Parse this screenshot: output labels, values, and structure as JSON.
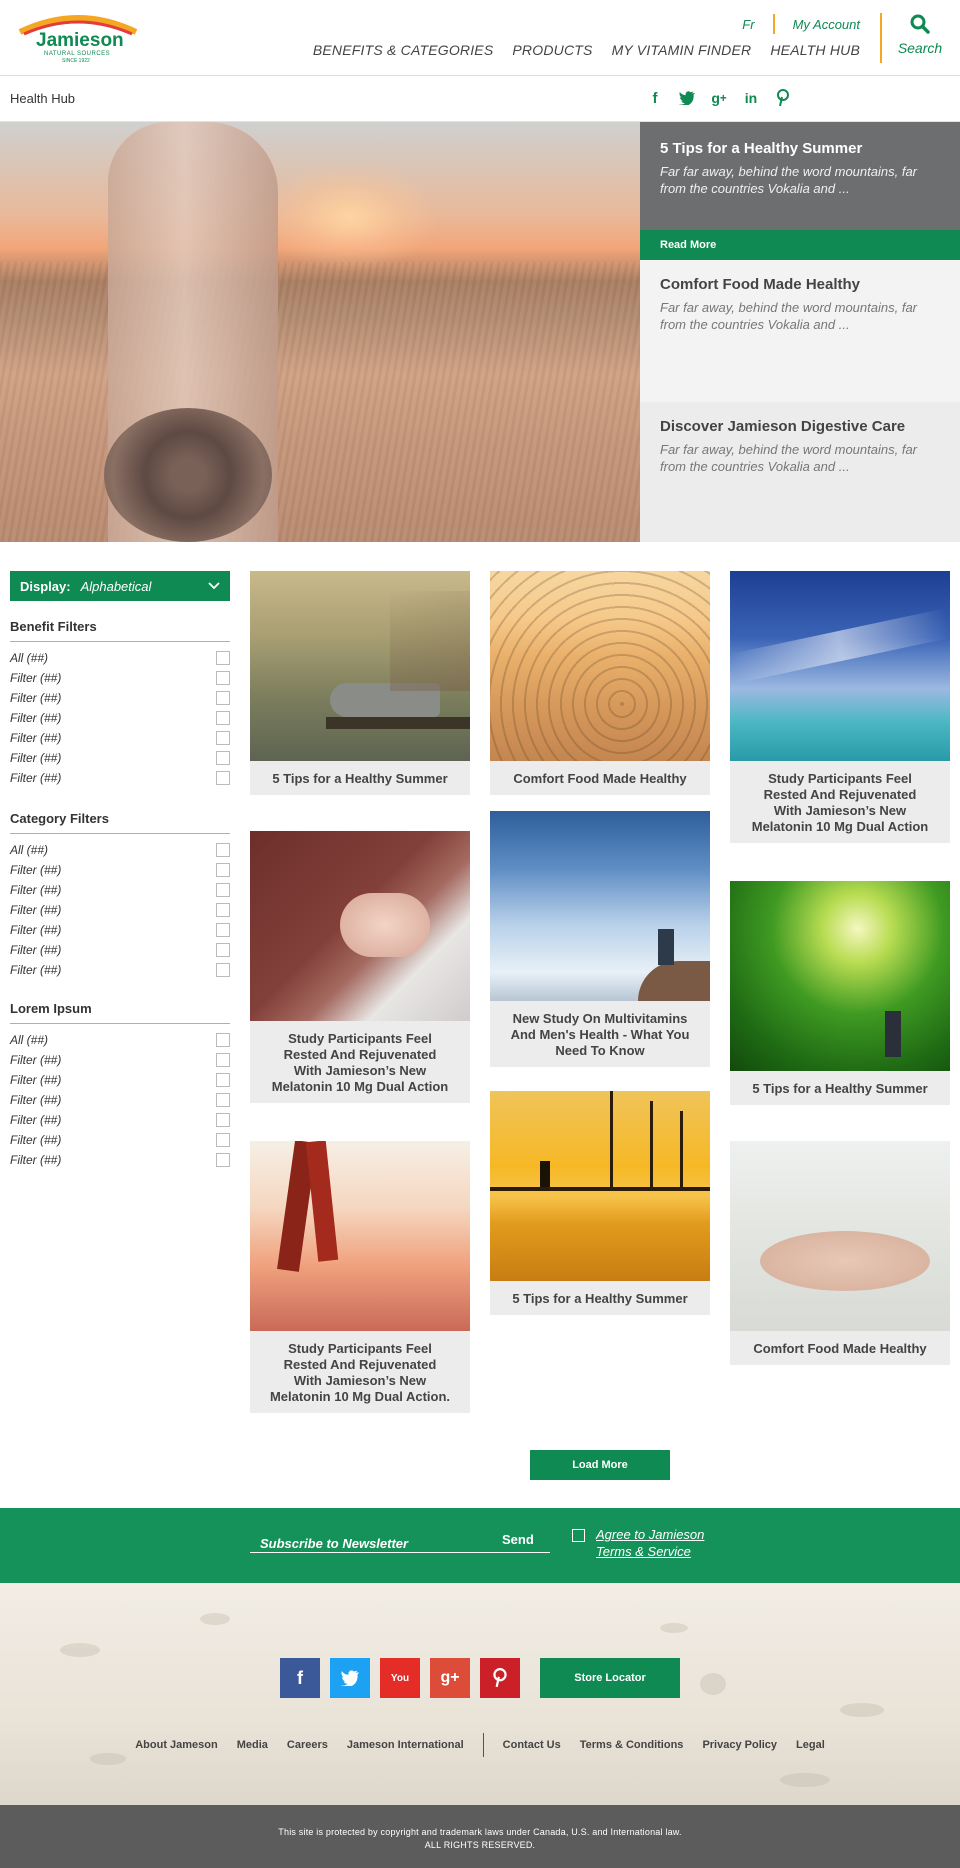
{
  "header": {
    "logo": {
      "brand": "Jamieson",
      "tagline": "NATURAL SOURCES",
      "since": "SINCE 1922"
    },
    "util": {
      "lang": "Fr",
      "account": "My Account"
    },
    "nav": [
      "BENEFITS & CATEGORIES",
      "PRODUCTS",
      "MY VITAMIN FINDER",
      "HEALTH HUB"
    ],
    "search_label": "Search"
  },
  "subbar": {
    "breadcrumb": "Health Hub",
    "social": [
      "facebook-icon",
      "twitter-icon",
      "google-plus-icon",
      "linkedin-icon",
      "pinterest-icon"
    ]
  },
  "hero": {
    "cards": [
      {
        "title": "5 Tips for a Healthy Summer",
        "excerpt": "Far far away, behind the word mountains, far from the countries Vokalia and ..."
      },
      {
        "title": "Comfort Food Made Healthy",
        "excerpt": "Far far away, behind the word mountains, far from the countries Vokalia and ..."
      },
      {
        "title": "Discover Jamieson Digestive Care",
        "excerpt": "Far far away, behind the word mountains, far from the countries Vokalia and ..."
      }
    ],
    "read_more": "Read More"
  },
  "sidebar": {
    "display_label": "Display:",
    "display_value": "Alphabetical",
    "groups": [
      {
        "title": "Benefit Filters",
        "items": [
          "All (##)",
          "Filter (##)",
          "Filter (##)",
          "Filter (##)",
          "Filter (##)",
          "Filter (##)",
          "Filter (##)"
        ]
      },
      {
        "title": "Category Filters",
        "items": [
          "All (##)",
          "Filter (##)",
          "Filter (##)",
          "Filter (##)",
          "Filter (##)",
          "Filter (##)",
          "Filter (##)"
        ]
      },
      {
        "title": "Lorem Ipsum",
        "items": [
          "All (##)",
          "Filter (##)",
          "Filter (##)",
          "Filter (##)",
          "Filter (##)",
          "Filter (##)",
          "Filter (##)"
        ]
      }
    ]
  },
  "grid": {
    "col1": [
      {
        "title": "5 Tips for a Healthy Summer"
      },
      {
        "title": "Study Participants Feel Rested And Rejuvenated With Jamieson’s New Melatonin 10 Mg Dual Action"
      },
      {
        "title": "Study Participants Feel Rested And Rejuvenated With Jamieson’s New Melatonin 10 Mg Dual Action."
      }
    ],
    "col2": [
      {
        "title": "Comfort Food Made Healthy"
      },
      {
        "title": "New Study On Multivitamins And Men's Health - What You Need To Know"
      },
      {
        "title": "5 Tips for a Healthy Summer"
      }
    ],
    "col3": [
      {
        "title": "Study Participants Feel Rested And Rejuvenated With Jamieson’s New Melatonin 10 Mg Dual Action"
      },
      {
        "title": "5 Tips for a Healthy Summer"
      },
      {
        "title": "Comfort Food Made Healthy"
      }
    ],
    "load_more": "Load More"
  },
  "newsletter": {
    "placeholder": "Subscribe to Newsletter",
    "send": "Send",
    "terms_line1": "Agree to Jamieson",
    "terms_line2": "Terms & Service"
  },
  "footer": {
    "social": [
      {
        "icon": "facebook-icon",
        "glyph": "f",
        "color": "#3b5998"
      },
      {
        "icon": "twitter-icon",
        "glyph": "t",
        "color": "#1da1f2"
      },
      {
        "icon": "youtube-icon",
        "glyph": "You",
        "color": "#e52d27"
      },
      {
        "icon": "google-plus-icon",
        "glyph": "g+",
        "color": "#dd4b39"
      },
      {
        "icon": "pinterest-icon",
        "glyph": "p",
        "color": "#cb2027"
      }
    ],
    "store_locator": "Store Locator",
    "links_left": [
      "About Jameson",
      "Media",
      "Careers",
      "Jameson International"
    ],
    "links_right": [
      "Contact Us",
      "Terms & Conditions",
      "Privacy Policy",
      "Legal"
    ],
    "copyright_line1": "This site is protected by copyright and trademark laws under Canada, U.S. and International law.",
    "copyright_line2": "ALL RIGHTS RESERVED."
  },
  "colors": {
    "brand_green": "#0e8a52",
    "accent_orange": "#f5a623",
    "grey_card": "#6d6e70"
  }
}
